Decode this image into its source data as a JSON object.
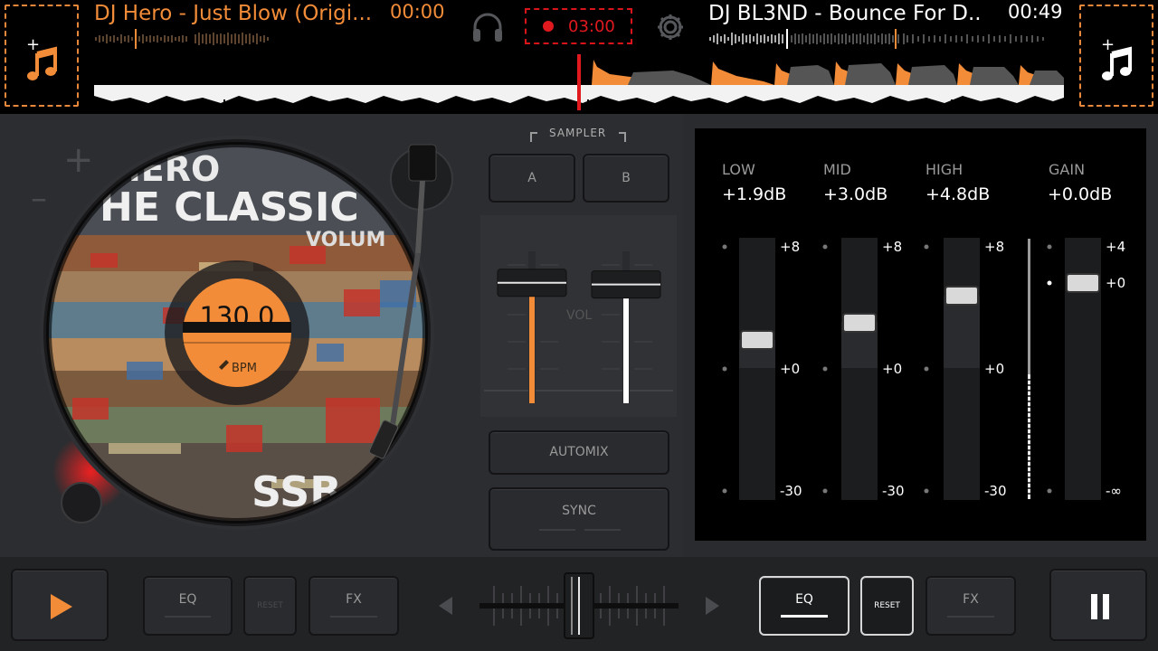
{
  "deck_left": {
    "track_title": "DJ Hero - Just Blow (Origi...",
    "time": "00:00",
    "bpm": "130,0",
    "bpm_label": "BPM",
    "cover_text_top": "HERO",
    "cover_text_mid": "HE CLASSIC",
    "cover_text_vol": "VOLUM",
    "cover_text_bottom": "SSB"
  },
  "deck_right": {
    "track_title": "DJ BL3ND - Bounce For D...",
    "time": "00:49"
  },
  "record": {
    "time": "03:00"
  },
  "sampler": {
    "label": "SAMPLER",
    "a": "A",
    "b": "B"
  },
  "volume": {
    "label": "VOL",
    "left_level": 0.74,
    "right_level": 0.73
  },
  "automix_label": "AUTOMIX",
  "sync_label": "SYNC",
  "eq": {
    "bands": [
      {
        "name": "LOW",
        "value": "+1.9dB",
        "top_mark": "+8",
        "mid_mark": "+0",
        "bottom_mark": "-30"
      },
      {
        "name": "MID",
        "value": "+3.0dB",
        "top_mark": "+8",
        "mid_mark": "+0",
        "bottom_mark": "-30"
      },
      {
        "name": "HIGH",
        "value": "+4.8dB",
        "top_mark": "+8",
        "mid_mark": "+0",
        "bottom_mark": "-30"
      }
    ],
    "gain": {
      "name": "GAIN",
      "value": "+0.0dB",
      "top_mark": "+4",
      "mid_mark": "+0",
      "bottom_mark": "-∞"
    }
  },
  "bottom": {
    "left_eq": "EQ",
    "left_reset": "RESET",
    "left_fx": "FX",
    "right_eq": "EQ",
    "right_reset": "RESET",
    "right_fx": "FX"
  },
  "colors": {
    "accent": "#f28c38",
    "record": "#e0191f",
    "panel": "#2c2d30"
  },
  "icons": {
    "add_track": "music-note-plus-icon",
    "headphones": "headphones-icon",
    "settings": "gear-icon",
    "play": "play-icon",
    "pause": "pause-icon"
  }
}
